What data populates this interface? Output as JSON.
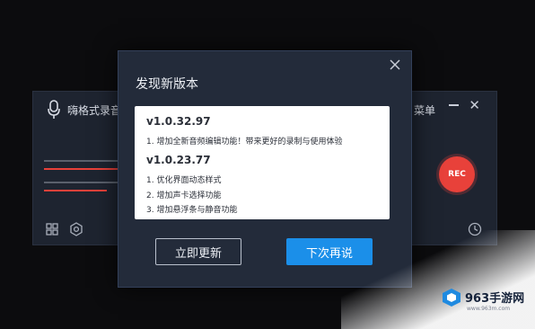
{
  "recorder": {
    "title": "嗨格式录音",
    "menu_label": "菜单",
    "rec_label": "REC"
  },
  "dialog": {
    "title": "发现新版本",
    "releases": [
      {
        "version": "v1.0.32.97",
        "notes": [
          "1. 增加全新音频编辑功能！带来更好的录制与使用体验"
        ]
      },
      {
        "version": "v1.0.23.77",
        "notes": [
          "1. 优化界面动态样式",
          "2. 增加声卡选择功能",
          "3. 增加悬浮条与静音功能"
        ]
      }
    ],
    "update_now_label": "立即更新",
    "later_label": "下次再说"
  },
  "watermark": {
    "brand": "963手游网",
    "url": "www.963m.com"
  },
  "colors": {
    "accent_blue": "#1b8fe9",
    "rec_red": "#e8413a",
    "dialog_bg": "#232b3a",
    "recorder_bg": "#1e2430"
  }
}
